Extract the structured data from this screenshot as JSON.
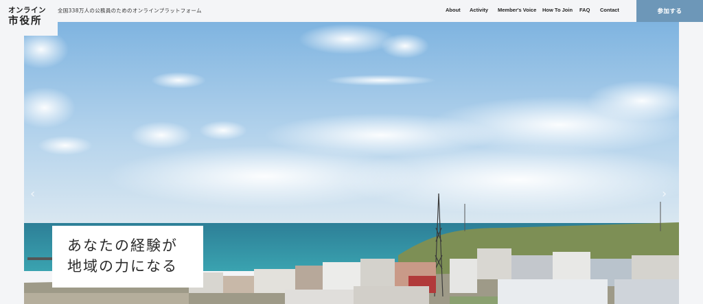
{
  "logo": {
    "line1": "オンライン",
    "line2": "市役所"
  },
  "tagline": "全国338万人の公務員のためのオンラインプラットフォーム",
  "nav": {
    "about": "About",
    "activity": "Activity",
    "voice": "Member's Voice",
    "join": "How To Join",
    "faq": "FAQ",
    "contact": "Contact"
  },
  "cta": {
    "join_label": "参加する"
  },
  "hero": {
    "catch_line1": "あなたの経験が",
    "catch_line2": "地域の力になる",
    "prev_arrow": "‹",
    "next_arrow": "›"
  },
  "colors": {
    "accent": "#6d97b8",
    "background": "#f4f5f7",
    "sky": "#8fbee4",
    "sea": "#2f8c9e"
  },
  "icons": {
    "prev": "chevron-left-icon",
    "next": "chevron-right-icon"
  }
}
